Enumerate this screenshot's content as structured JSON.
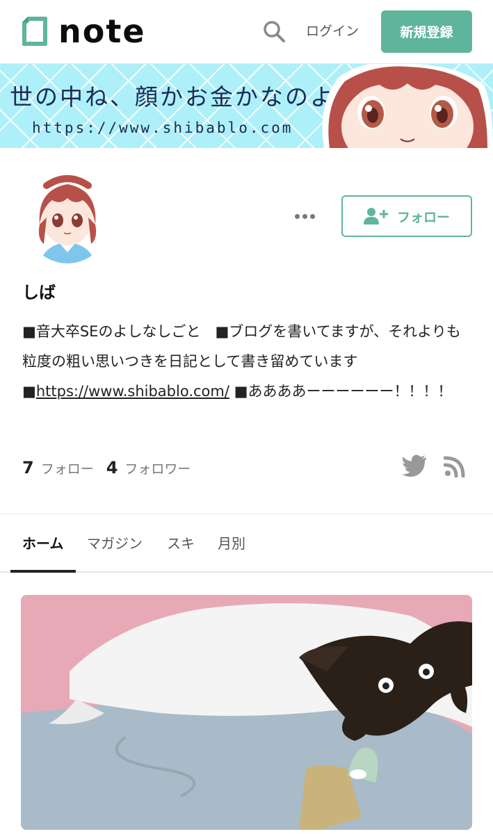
{
  "header": {
    "logo_text": "note",
    "login_label": "ログイン",
    "signup_label": "新規登録"
  },
  "banner": {
    "title": "世の中ね、顔かお金かなのよ",
    "url": "https://www.shibablo.com"
  },
  "profile": {
    "name": "しば",
    "bio_part1": "■音大卒SEのよしなしごと　■ブログを書いてますが、それよりも粒度の粗い思いつきを日記として書き留めています　■",
    "bio_link": "https://www.shibablo.com/",
    "bio_part2": " ■ああああーーーーーー！！！！",
    "follow_label": "フォロー",
    "following_count": "7",
    "following_label": "フォロー",
    "followers_count": "4",
    "followers_label": "フォロワー"
  },
  "tabs": [
    {
      "label": "ホーム",
      "active": true
    },
    {
      "label": "マガジン",
      "active": false
    },
    {
      "label": "スキ",
      "active": false
    },
    {
      "label": "月別",
      "active": false
    }
  ],
  "icons": {
    "search": "search-icon",
    "more": "more-icon",
    "follow": "user-plus-icon",
    "twitter": "twitter-icon",
    "rss": "rss-icon"
  },
  "colors": {
    "accent": "#5fb49c",
    "banner_bg": "#aef0f9",
    "text": "#222222",
    "muted": "#777777"
  }
}
